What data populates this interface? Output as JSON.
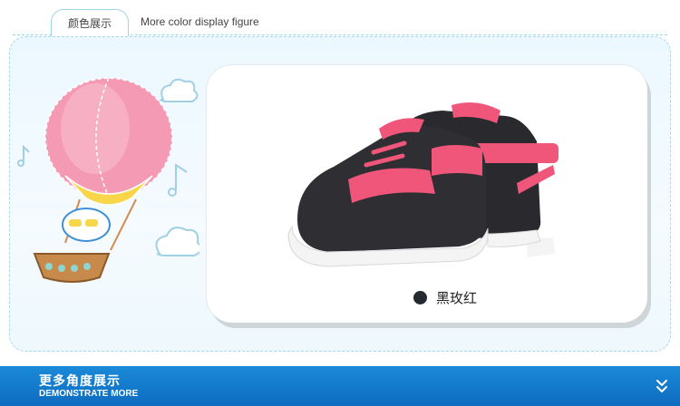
{
  "header": {
    "tab_label": "颜色展示",
    "subtitle": "More color display figure"
  },
  "product": {
    "variant_name": "黑玫红",
    "swatch_color": "#262a30",
    "shoe_colors": {
      "body": "#2a2a2e",
      "accent": "#f0557a",
      "sole": "#f4f4f4"
    }
  },
  "footer": {
    "title": "更多角度展示",
    "subtitle": "DEMONSTRATE MORE",
    "icon": "chevron-double-down-icon"
  },
  "colors": {
    "footer_bar": "#0e6cc0",
    "panel_border": "#a8d8ea",
    "accent_pink": "#f0557a"
  }
}
